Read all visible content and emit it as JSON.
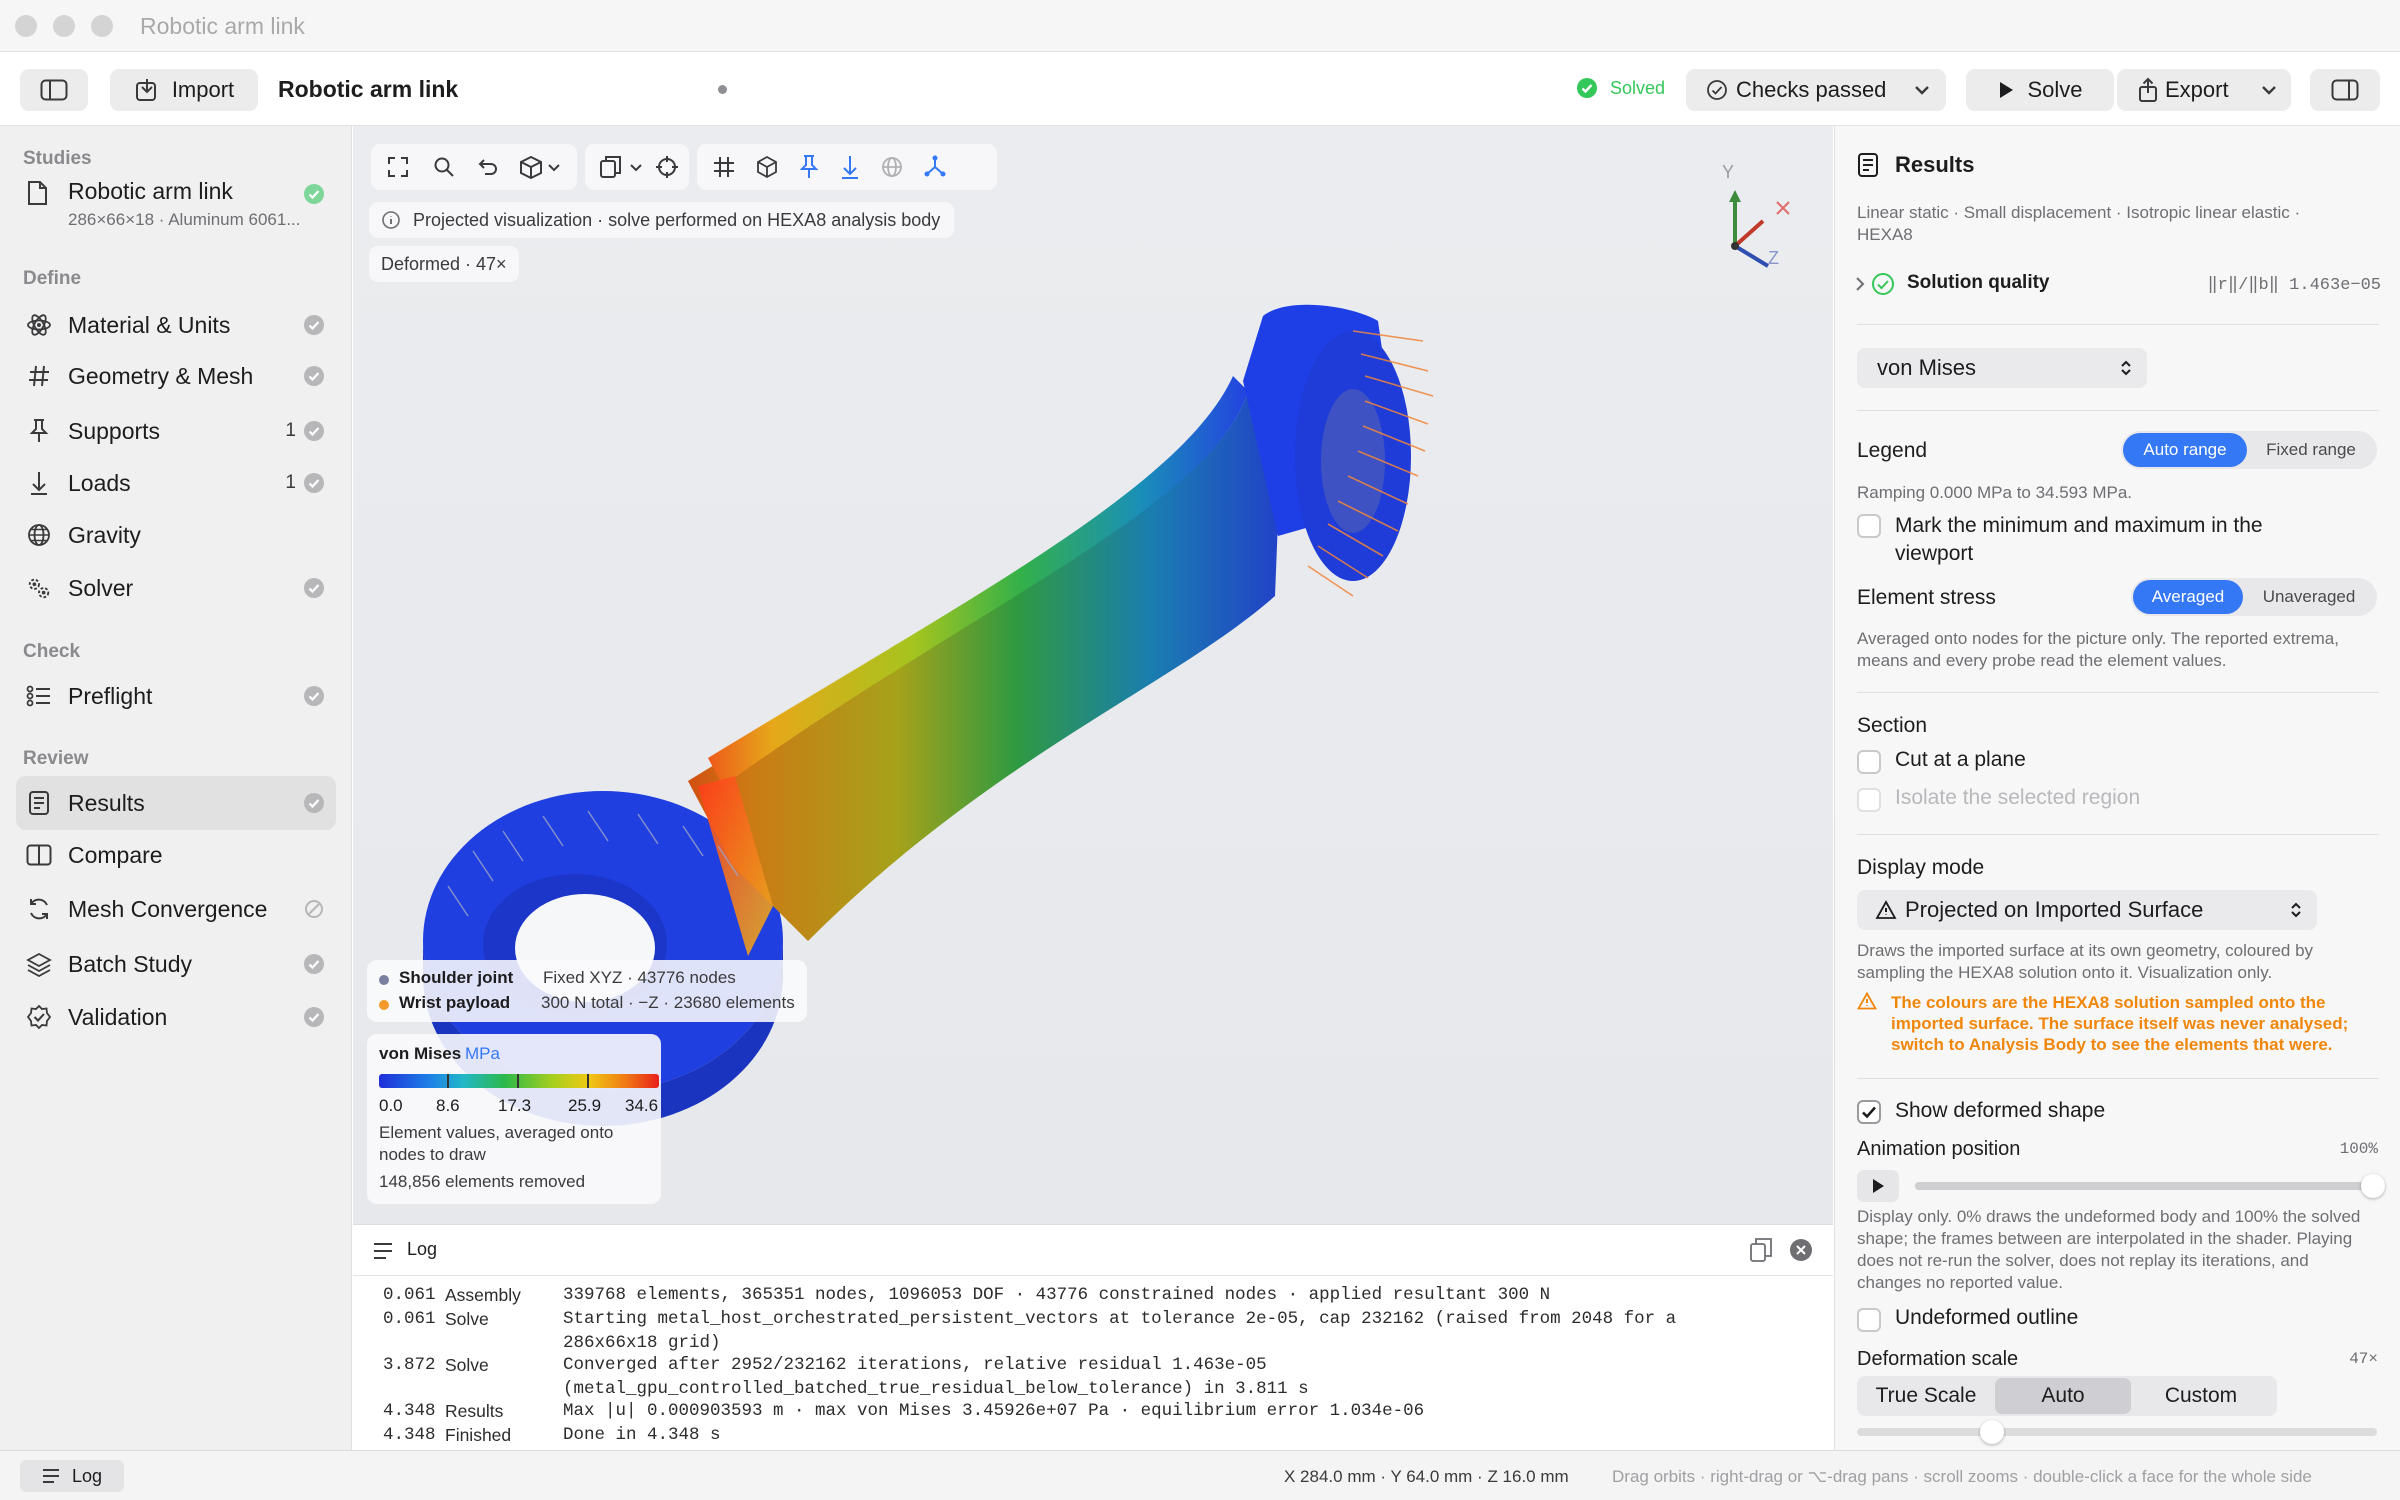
{
  "window": {
    "title": "Robotic arm link"
  },
  "toolbar": {
    "import_label": "Import",
    "doc_title": "Robotic arm link",
    "status": "Solved",
    "checks_label": "Checks passed",
    "solve_label": "Solve",
    "export_label": "Export"
  },
  "sidebar": {
    "studies_header": "Studies",
    "study": {
      "name": "Robotic arm link",
      "subtitle": "286×66×18 · Aluminum 6061..."
    },
    "define_header": "Define",
    "define_items": [
      {
        "label": "Material & Units",
        "icon": "atom-icon",
        "count": ""
      },
      {
        "label": "Geometry & Mesh",
        "icon": "hash-icon",
        "count": ""
      },
      {
        "label": "Supports",
        "icon": "pin-icon",
        "count": "1"
      },
      {
        "label": "Loads",
        "icon": "arrow-down-icon",
        "count": "1"
      },
      {
        "label": "Gravity",
        "icon": "globe-icon",
        "count": ""
      },
      {
        "label": "Solver",
        "icon": "gears-icon",
        "count": ""
      }
    ],
    "check_header": "Check",
    "check_items": [
      {
        "label": "Preflight",
        "icon": "checklist-icon"
      }
    ],
    "review_header": "Review",
    "review_items": [
      {
        "label": "Results",
        "icon": "document-icon"
      },
      {
        "label": "Compare",
        "icon": "compare-icon"
      },
      {
        "label": "Mesh Convergence",
        "icon": "refresh-icon"
      },
      {
        "label": "Batch Study",
        "icon": "layers-icon"
      },
      {
        "label": "Validation",
        "icon": "badge-check-icon"
      }
    ]
  },
  "viewport": {
    "info_chip": "Projected visualization · solve performed on HEXA8 analysis body",
    "deformed_chip": "Deformed · 47×",
    "axis_y": "Y",
    "axis_z": "Z",
    "support_name": "Shoulder joint",
    "support_detail": "Fixed XYZ · 43776 nodes",
    "load_name": "Wrist payload",
    "load_detail": "300 N total · −Z · 23680 elements",
    "legend": {
      "title": "von Mises",
      "unit": "MPa",
      "ticks": [
        "0.0",
        "8.6",
        "17.3",
        "25.9",
        "34.6"
      ],
      "note": "Element values, averaged onto nodes to draw",
      "removed": "148,856 elements removed"
    }
  },
  "log": {
    "title": "Log",
    "rows": [
      {
        "time": "0.061",
        "stage": "Assembly",
        "text": "339768 elements, 365351 nodes, 1096053 DOF · 43776 constrained nodes · applied resultant 300 N"
      },
      {
        "time": "0.061",
        "stage": "Solve",
        "text": "Starting metal_host_orchestrated_persistent_vectors at tolerance 2e-05, cap 232162 (raised from 2048 for a"
      },
      {
        "time": "",
        "stage": "",
        "text": "286x66x18 grid)"
      },
      {
        "time": "3.872",
        "stage": "Solve",
        "text": "Converged after 2952/232162 iterations, relative residual 1.463e-05"
      },
      {
        "time": "",
        "stage": "",
        "text": "(metal_gpu_controlled_batched_true_residual_below_tolerance) in 3.811 s"
      },
      {
        "time": "4.348",
        "stage": "Results",
        "text": "Max |u| 0.000903593 m · max von Mises 3.45926e+07 Pa · equilibrium error 1.034e-06"
      },
      {
        "time": "4.348",
        "stage": "Finished",
        "text": "Done in 4.348 s"
      }
    ]
  },
  "statusbar": {
    "log_button": "Log",
    "coords": "X 284.0 mm · Y 64.0 mm · Z 16.0 mm",
    "hint": "Drag orbits · right-drag or ⌥-drag pans · scroll zooms · double-click a face for the whole side"
  },
  "results": {
    "title": "Results",
    "subtitle": "Linear static · Small displacement · Isotropic linear elastic · HEXA8",
    "quality_label": "Solution quality",
    "quality_value": "‖r‖/‖b‖ 1.463e−05",
    "field_select": "von Mises",
    "legend_label": "Legend",
    "legend_options": [
      "Auto range",
      "Fixed range"
    ],
    "legend_note": "Ramping 0.000 MPa to 34.593 MPa.",
    "mark_minmax": "Mark the minimum and maximum in the viewport",
    "element_stress_label": "Element stress",
    "stress_options": [
      "Averaged",
      "Unaveraged"
    ],
    "stress_note": "Averaged onto nodes for the picture only. The reported extrema, means and every probe read the element values.",
    "section_label": "Section",
    "cut_plane": "Cut at a plane",
    "isolate": "Isolate the selected region",
    "display_mode_label": "Display mode",
    "display_mode_value": "Projected on Imported Surface",
    "display_note": "Draws the imported surface at its own geometry, coloured by sampling the HEXA8 solution onto it. Visualization only.",
    "warning": "The colours are the HEXA8 solution sampled onto the imported surface. The surface itself was never analysed; switch to Analysis Body to see the elements that were.",
    "show_deformed": "Show deformed shape",
    "anim_label": "Animation position",
    "anim_value": "100%",
    "anim_fraction": 1.0,
    "anim_note": "Display only. 0% draws the undeformed body and 100% the solved shape; the frames between are interpolated in the shader. Playing does not re-run the solver, does not replay its iterations, and changes no reported value.",
    "undeformed_outline": "Undeformed outline",
    "deform_scale_label": "Deformation scale",
    "deform_scale_value": "47×",
    "scale_options": [
      "True Scale",
      "Auto",
      "Custom"
    ],
    "scale_fraction": 0.26
  },
  "colors": {
    "accent": "#3478f6",
    "solved": "#34c759",
    "warning": "#f0860a",
    "support_dot": "#7a7fa0",
    "load_dot": "#f39a2a"
  }
}
